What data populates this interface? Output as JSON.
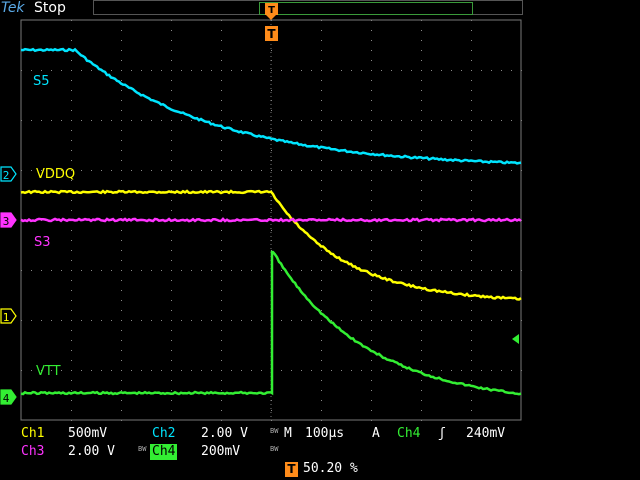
{
  "brand": "Tek",
  "run_state": "Stop",
  "trigger_marker": "T",
  "channels": [
    {
      "id": "ch1",
      "marker": "1",
      "label": "Ch1",
      "scale": "500mV",
      "color": "#ffff00"
    },
    {
      "id": "ch2",
      "marker": "2",
      "label": "Ch2",
      "scale": "2.00 V",
      "color": "#00e5ff"
    },
    {
      "id": "ch3",
      "marker": "3",
      "label": "Ch3",
      "scale": "2.00 V",
      "color": "#ff33ff"
    },
    {
      "id": "ch4",
      "marker": "4",
      "label": "Ch4",
      "scale": "200mV",
      "color": "#33ee33"
    }
  ],
  "trace_labels": {
    "s5": "S5",
    "vddq": "VDDQ",
    "s3": "S3",
    "vtt": "VTT"
  },
  "horizontal": {
    "prefix": "M",
    "timebase": "100µs",
    "trig_prefix": "A",
    "trig_source": "Ch4",
    "trig_slope": "ʃ",
    "trig_level": "240mV"
  },
  "bw_mark": "BW",
  "trigger_position": "50.20 %"
}
